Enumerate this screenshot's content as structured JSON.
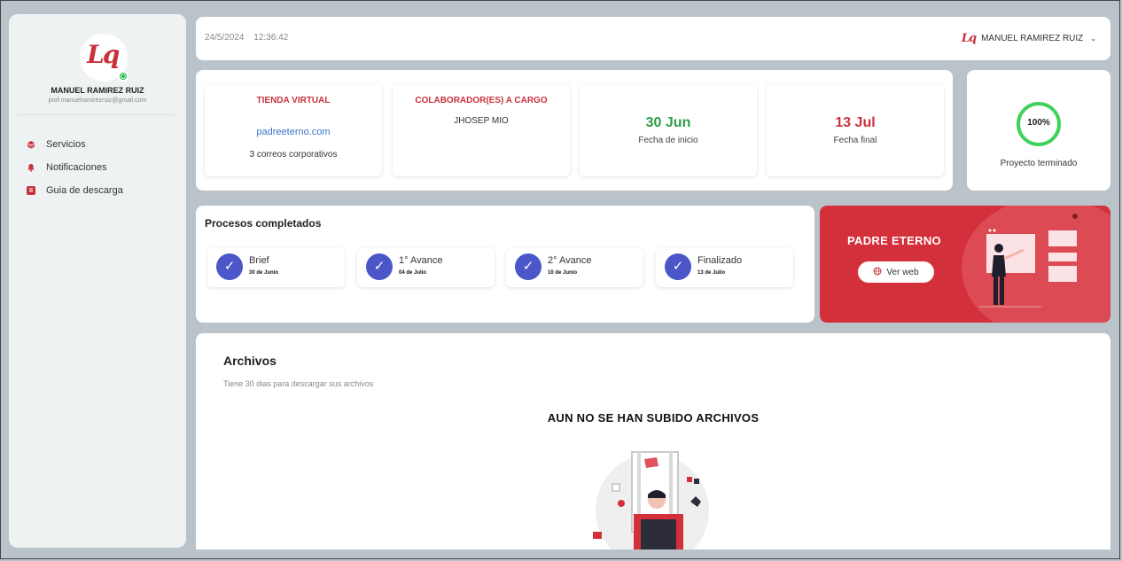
{
  "sidebar": {
    "logo_text": "Lq",
    "user_name": "MANUEL RAMIREZ RUIZ",
    "user_email": "prof.manuelramirezruiz@gmail.com",
    "items": [
      {
        "label": "Servicios",
        "icon": "layers-icon"
      },
      {
        "label": "Notificaciones",
        "icon": "bell-icon"
      },
      {
        "label": "Guia de descarga",
        "icon": "book-icon"
      }
    ]
  },
  "header": {
    "date": "24/5/2024",
    "time": "12:36:42",
    "user_logo": "Lq",
    "user_name": "MANUEL RAMIREZ RUIZ"
  },
  "info": {
    "store": {
      "title": "TIENDA VIRTUAL",
      "link": "padreeterno.com",
      "sub": "3 correos corporativos"
    },
    "collaborators": {
      "title": "COLABORADOR(ES) A CARGO",
      "name": "JHOSEP MIO"
    },
    "start": {
      "date": "30 Jun",
      "caption": "Fecha de inicio"
    },
    "end": {
      "date": "13 Jul",
      "caption": "Fecha final"
    }
  },
  "progress": {
    "value": "100%",
    "label": "Proyecto terminado"
  },
  "processes": {
    "title": "Procesos completados",
    "steps": [
      {
        "name": "Brief",
        "date": "30 de Junio"
      },
      {
        "name": "1° Avance",
        "date": "04 de Julio"
      },
      {
        "name": "2° Avance",
        "date": "10 de Junio"
      },
      {
        "name": "Finalizado",
        "date": "13 de Julio"
      }
    ]
  },
  "promo": {
    "title": "PADRE ETERNO",
    "button": "Ver web"
  },
  "files": {
    "title": "Archivos",
    "subtitle": "Tiene 30 dias para descargar sus archivos",
    "empty": "AUN NO SE HAN SUBIDO ARCHIVOS"
  },
  "colors": {
    "brand_red": "#c8323c",
    "check_blue": "#4b56c9",
    "progress_green": "#3fd25b",
    "start_green": "#2e9d45"
  }
}
